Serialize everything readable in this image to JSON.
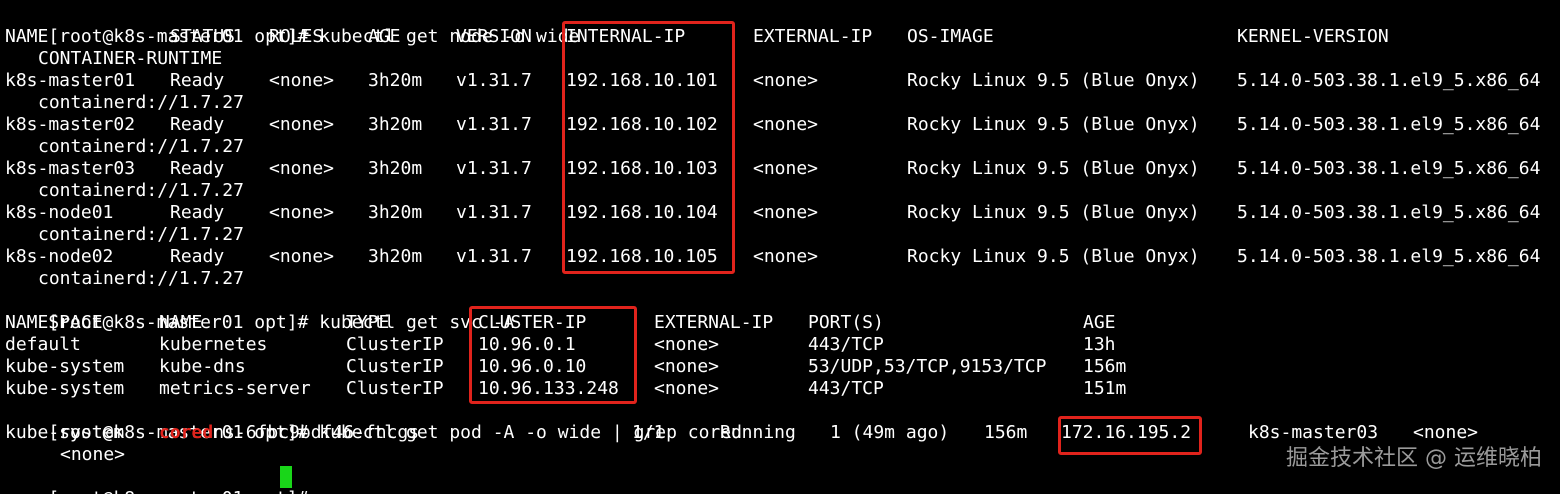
{
  "prompt": "[root@k8s-master01 opt]# ",
  "commands": [
    "kubectl get node -o wide",
    "kubectl get svc -A",
    "kubectl get pod -A -o wide | grep cored"
  ],
  "nodes": {
    "headers": [
      "NAME",
      "STATUS",
      "ROLES",
      "AGE",
      "VERSION",
      "INTERNAL-IP",
      "EXTERNAL-IP",
      "OS-IMAGE",
      "KERNEL-VERSION"
    ],
    "header_cont": "CONTAINER-RUNTIME",
    "rows": [
      {
        "name": "k8s-master01",
        "status": "Ready",
        "roles": "<none>",
        "age": "3h20m",
        "version": "v1.31.7",
        "internal_ip": "192.168.10.101",
        "external_ip": "<none>",
        "os_image": "Rocky Linux 9.5 (Blue Onyx)",
        "kernel": "5.14.0-503.38.1.el9_5.x86_64",
        "runtime": "containerd://1.7.27"
      },
      {
        "name": "k8s-master02",
        "status": "Ready",
        "roles": "<none>",
        "age": "3h20m",
        "version": "v1.31.7",
        "internal_ip": "192.168.10.102",
        "external_ip": "<none>",
        "os_image": "Rocky Linux 9.5 (Blue Onyx)",
        "kernel": "5.14.0-503.38.1.el9_5.x86_64",
        "runtime": "containerd://1.7.27"
      },
      {
        "name": "k8s-master03",
        "status": "Ready",
        "roles": "<none>",
        "age": "3h20m",
        "version": "v1.31.7",
        "internal_ip": "192.168.10.103",
        "external_ip": "<none>",
        "os_image": "Rocky Linux 9.5 (Blue Onyx)",
        "kernel": "5.14.0-503.38.1.el9_5.x86_64",
        "runtime": "containerd://1.7.27"
      },
      {
        "name": "k8s-node01",
        "status": "Ready",
        "roles": "<none>",
        "age": "3h20m",
        "version": "v1.31.7",
        "internal_ip": "192.168.10.104",
        "external_ip": "<none>",
        "os_image": "Rocky Linux 9.5 (Blue Onyx)",
        "kernel": "5.14.0-503.38.1.el9_5.x86_64",
        "runtime": "containerd://1.7.27"
      },
      {
        "name": "k8s-node02",
        "status": "Ready",
        "roles": "<none>",
        "age": "3h20m",
        "version": "v1.31.7",
        "internal_ip": "192.168.10.105",
        "external_ip": "<none>",
        "os_image": "Rocky Linux 9.5 (Blue Onyx)",
        "kernel": "5.14.0-503.38.1.el9_5.x86_64",
        "runtime": "containerd://1.7.27"
      }
    ]
  },
  "services": {
    "headers": [
      "NAMESPACE",
      "NAME",
      "TYPE",
      "CLUSTER-IP",
      "EXTERNAL-IP",
      "PORT(S)",
      "AGE"
    ],
    "rows": [
      {
        "namespace": "default",
        "name": "kubernetes",
        "type": "ClusterIP",
        "cluster_ip": "10.96.0.1",
        "external_ip": "<none>",
        "ports": "443/TCP",
        "age": "13h"
      },
      {
        "namespace": "kube-system",
        "name": "kube-dns",
        "type": "ClusterIP",
        "cluster_ip": "10.96.0.10",
        "external_ip": "<none>",
        "ports": "53/UDP,53/TCP,9153/TCP",
        "age": "156m"
      },
      {
        "namespace": "kube-system",
        "name": "metrics-server",
        "type": "ClusterIP",
        "cluster_ip": "10.96.133.248",
        "external_ip": "<none>",
        "ports": "443/TCP",
        "age": "151m"
      }
    ]
  },
  "pod": {
    "namespace": "kube-system",
    "name_match": "cored",
    "name_rest": "ns-6fbc9bdf46-fncgs",
    "ready": "1/1",
    "status": "Running",
    "restarts": "1 (49m ago)",
    "age": "156m",
    "ip": "172.16.195.2",
    "node": "k8s-master03",
    "nominated_node": "<none>",
    "readiness_gates": "<none>"
  },
  "watermark": "掘金技术社区 @ 运维晓柏",
  "colors": {
    "background": "#000000",
    "foreground": "#ffffff",
    "highlight": "#e0231c",
    "cursor": "#19d619",
    "watermark": "#9a9a9a"
  }
}
